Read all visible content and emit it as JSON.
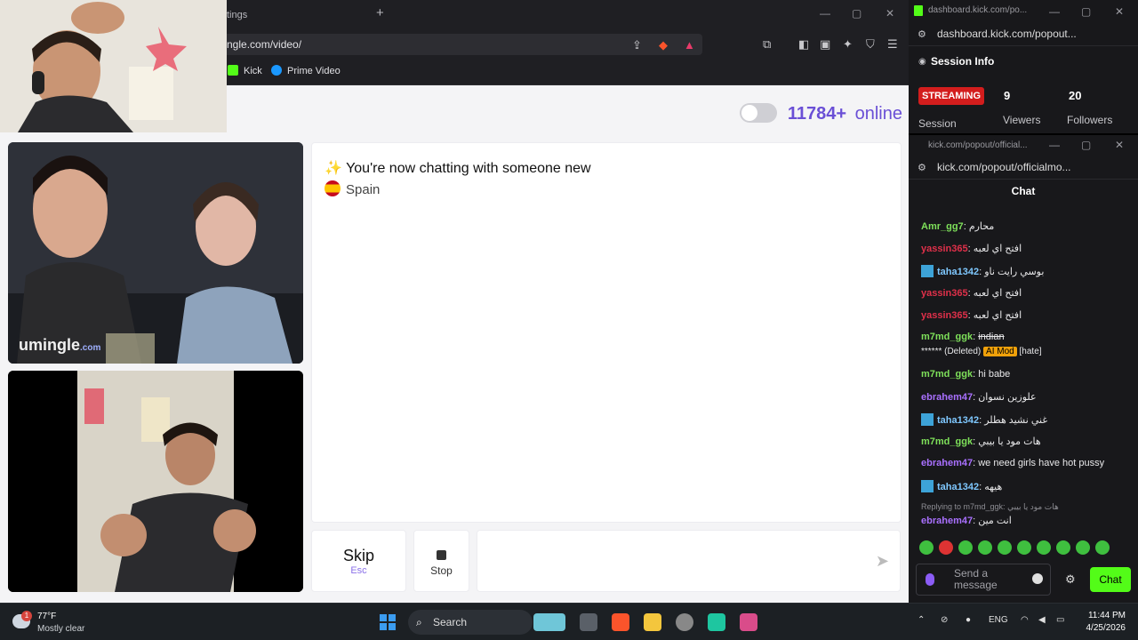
{
  "browser": {
    "tab_title": "tings",
    "new_tab": "+",
    "url": "ngle.com/video/",
    "bookmarks": [
      "Kick",
      "Prime Video"
    ]
  },
  "site": {
    "online_count": "11784+",
    "online_label": "online",
    "new_chat_text": "✨ You're now chatting with someone new",
    "country": "Spain",
    "watermark": "umingle",
    "watermark_suffix": ".com",
    "skip_label": "Skip",
    "skip_key": "Esc",
    "stop_label": "Stop",
    "send_icon": "send-arrow"
  },
  "session_window": {
    "title": "dashboard.kick.com/po...",
    "url": "dashboard.kick.com/popout...",
    "heading": "Session Info",
    "status_badge": "STREAMING",
    "session_label": "Session",
    "viewers_value": "9",
    "viewers_label": "Viewers",
    "followers_value": "20",
    "followers_label": "Followers"
  },
  "chat_window": {
    "title": "kick.com/popout/official...",
    "url": "kick.com/popout/officialmo...",
    "heading": "Chat",
    "messages": [
      {
        "user": "Amr_gg7",
        "color": "#7ee05a",
        "text": "محارم",
        "badge": false
      },
      {
        "user": "yassin365",
        "color": "#e0304a",
        "text": "افتح اي لعبه",
        "badge": false
      },
      {
        "user": "taha1342",
        "color": "#7fc8ff",
        "text": "بوسي رايت ناو",
        "badge": true
      },
      {
        "user": "yassin365",
        "color": "#e0304a",
        "text": "افتح اي لعبه",
        "badge": false
      },
      {
        "user": "yassin365",
        "color": "#e0304a",
        "text": "افتح اي لعبه",
        "badge": false
      },
      {
        "user": "m7md_ggk",
        "color": "#7ee05a",
        "text": "indian",
        "badge": false
      }
    ],
    "deleted_text": "****** (Deleted)",
    "ai_mod_label": "AI Mod",
    "hate_label": "[hate]",
    "messages2": [
      {
        "user": "m7md_ggk",
        "color": "#7ee05a",
        "text": "hi babe",
        "badge": false
      },
      {
        "user": "ebrahem47",
        "color": "#a970ff",
        "text": "علوزين نسوان",
        "badge": false
      },
      {
        "user": "taha1342",
        "color": "#7fc8ff",
        "text": "غني نشيد هطلر",
        "badge": true
      },
      {
        "user": "m7md_ggk",
        "color": "#7ee05a",
        "text": "هات مود يا بيبي",
        "badge": false
      },
      {
        "user": "ebrahem47",
        "color": "#a970ff",
        "text": "we need girls have hot pussy",
        "badge": false
      },
      {
        "user": "taha1342",
        "color": "#7fc8ff",
        "text": "هيهه",
        "badge": true
      }
    ],
    "reply_text": "Replying to m7md_ggk: هات مود يا بيبي",
    "last_message": {
      "user": "ebrahem47",
      "color": "#a970ff",
      "text": "انت مين"
    },
    "send_placeholder_1": "Send a",
    "send_placeholder_2": "message",
    "chat_button": "Chat"
  },
  "taskbar": {
    "weather_badge": "1",
    "temperature": "77°F",
    "weather": "Mostly clear",
    "search": "Search",
    "lang": "ENG",
    "time": "11:44 PM",
    "date": "4/25/2026"
  }
}
